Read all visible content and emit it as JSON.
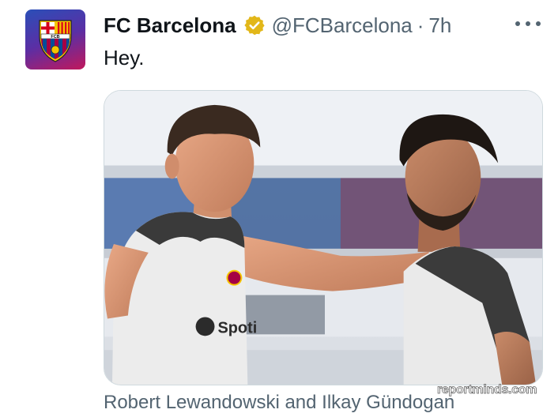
{
  "tweet": {
    "author_name": "FC Barcelona",
    "handle": "@FCBarcelona",
    "separator": "·",
    "time": "7h",
    "text": "Hey."
  },
  "media": {
    "alt": "Two FC Barcelona players in training shirts facing each other",
    "caption": "Robert Lewandowski and Ilkay Gündogan",
    "watermark": "reportminds.com",
    "shirt_sponsor": "Spoti",
    "crest_letters": "FCB"
  },
  "icons": {
    "verified": "verified-badge-icon",
    "more": "more-horizontal-icon"
  },
  "colors": {
    "verified_badge": "#e2b719",
    "secondary_text": "#536471",
    "primary_text": "#0f1419"
  }
}
